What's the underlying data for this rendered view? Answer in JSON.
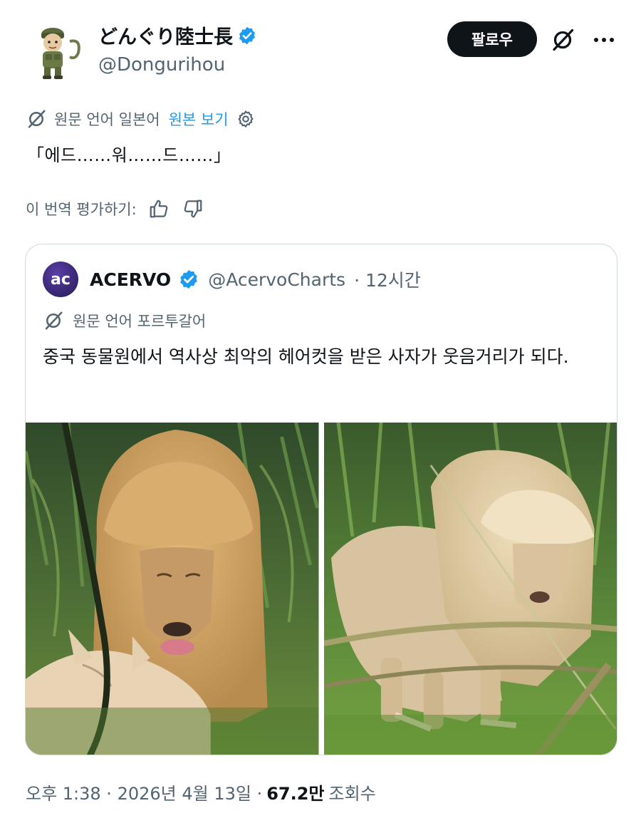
{
  "author": {
    "display_name": "どんぐり陸士長",
    "handle": "@Dongurihou"
  },
  "actions": {
    "follow_label": "팔로우",
    "grok_icon": "grok-icon",
    "more_icon": "more-dots-icon"
  },
  "translation": {
    "source_label": "원문 언어 일본어",
    "show_original": "원본 보기"
  },
  "tweet": {
    "text": "「에드……워……드……」"
  },
  "rating": {
    "label": "이 번역 평가하기:"
  },
  "quote": {
    "avatar_text": "ac",
    "display_name": "ACERVO",
    "handle": "@AcervoCharts",
    "time": "· 12시간",
    "translation_label": "원문 언어 포르투갈어",
    "text": "중국 동물원에서 역사상 최악의 헤어컷을 받은 사자가 웃음거리가 되다."
  },
  "footer": {
    "time": "오후 1:38 · 2026년 4월 13일 ·",
    "views_count": "67.2만",
    "views_label": "조회수"
  },
  "colors": {
    "accent": "#1d9bf0",
    "text": "#0f1419",
    "secondary": "#536471",
    "border": "#cfd9de"
  }
}
